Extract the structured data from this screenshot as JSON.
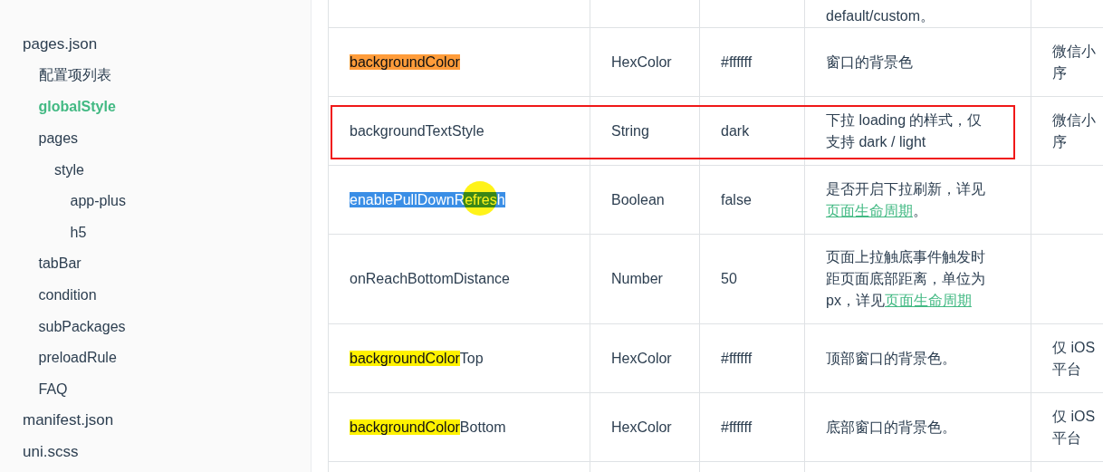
{
  "sidebar": {
    "items": [
      {
        "label": "pages.json",
        "selected": false,
        "children": [
          {
            "label": "配置项列表",
            "selected": false
          },
          {
            "label": "globalStyle",
            "selected": true
          },
          {
            "label": "pages",
            "selected": false,
            "children": [
              {
                "label": "style",
                "selected": false,
                "children": [
                  {
                    "label": "app-plus",
                    "selected": false
                  },
                  {
                    "label": "h5",
                    "selected": false
                  }
                ]
              }
            ]
          },
          {
            "label": "tabBar",
            "selected": false
          },
          {
            "label": "condition",
            "selected": false
          },
          {
            "label": "subPackages",
            "selected": false
          },
          {
            "label": "preloadRule",
            "selected": false
          },
          {
            "label": "FAQ",
            "selected": false
          }
        ]
      },
      {
        "label": "manifest.json",
        "selected": false
      },
      {
        "label": "uni.scss",
        "selected": false
      }
    ]
  },
  "table": {
    "rows": [
      {
        "kind": "partial-top",
        "property": [],
        "type": "",
        "default": "",
        "description": [
          {
            "kind": "text",
            "text": "default/custom。"
          }
        ],
        "platform": [],
        "outlined": false,
        "cursor": false
      },
      {
        "kind": "row",
        "property": [
          {
            "text": "backgroundColor",
            "color": "#ff9c3a"
          }
        ],
        "type": "HexColor",
        "default": "#ffffff",
        "description": [
          {
            "kind": "text",
            "text": "窗口的背景色"
          }
        ],
        "platform": [
          "微信小",
          "序"
        ],
        "outlined": false,
        "cursor": false
      },
      {
        "kind": "row",
        "property": [
          {
            "text": "backgroundTextStyle"
          }
        ],
        "type": "String",
        "default": "dark",
        "description": [
          {
            "kind": "text",
            "text": "下拉 loading 的样式，仅支持 dark / light"
          }
        ],
        "platform": [
          "微信小",
          "序"
        ],
        "outlined": true,
        "cursor": false
      },
      {
        "kind": "row",
        "property": [
          {
            "text": "enablePullDownRefresh",
            "color": "#3a8ee6"
          }
        ],
        "type": "Boolean",
        "default": "false",
        "description": [
          {
            "kind": "text",
            "text": "是否开启下拉刷新，详见"
          },
          {
            "kind": "link",
            "text": "页面生命周期"
          },
          {
            "kind": "text",
            "text": "。"
          }
        ],
        "platform": [],
        "outlined": false,
        "cursor": true
      },
      {
        "kind": "row",
        "property": [
          {
            "text": "onReachBottomDistance"
          }
        ],
        "type": "Number",
        "default": "50",
        "description": [
          {
            "kind": "text",
            "text": "页面上拉触底事件触发时距页面底部距离，单位为px，详见"
          },
          {
            "kind": "link",
            "text": "页面生命周期"
          }
        ],
        "platform": [],
        "outlined": false,
        "cursor": false
      },
      {
        "kind": "row",
        "property": [
          {
            "text": "backgroundColor",
            "color": "#fff200"
          },
          {
            "text": "Top"
          }
        ],
        "type": "HexColor",
        "default": "#ffffff",
        "description": [
          {
            "kind": "text",
            "text": "顶部窗口的背景色。"
          }
        ],
        "platform": [
          "仅 iOS",
          "平台"
        ],
        "outlined": false,
        "cursor": false
      },
      {
        "kind": "row",
        "property": [
          {
            "text": "backgroundColor",
            "color": "#fff200"
          },
          {
            "text": "Bottom"
          }
        ],
        "type": "HexColor",
        "default": "#ffffff",
        "description": [
          {
            "kind": "text",
            "text": "底部窗口的背景色。"
          }
        ],
        "platform": [
          "仅 iOS",
          "平台"
        ],
        "outlined": false,
        "cursor": false
      },
      {
        "kind": "partial-bottom",
        "property": [],
        "type": "",
        "default": "",
        "description": [],
        "platform": [],
        "outlined": false,
        "cursor": false
      }
    ]
  }
}
